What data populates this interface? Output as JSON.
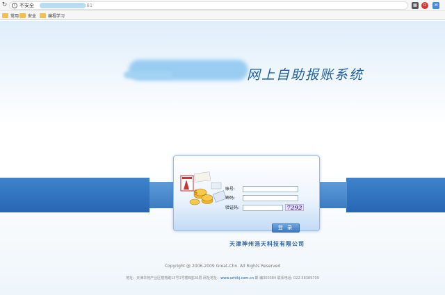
{
  "browser": {
    "security_warning": "不安全",
    "url_port": ":81",
    "bookmarks": [
      "常用",
      "安全",
      "编程学习"
    ]
  },
  "header": {
    "site_title": "网上自助报账系统"
  },
  "login": {
    "account_label": "账号:",
    "password_label": "密码:",
    "captcha_label": "验证码:",
    "captcha_code": "7292",
    "login_button": "登 录",
    "company_name": "天津神州浩天科技有限公司"
  },
  "footer": {
    "copyright": "Copyright @ 2006-2009 Great-Chn. All Rights Reserved",
    "address_prefix": "地址：天津华苑产业区榕苑路15号1号楼B座20层 网址地址：",
    "website": "www.szhtkj.com.cn",
    "address_suffix": " 邮 编300384 联系电话: 022-58389709"
  },
  "colors": {
    "accent_blue": "#2866b3",
    "title_blue": "#1d5fa6",
    "captcha_purple": "#5b3fae"
  }
}
